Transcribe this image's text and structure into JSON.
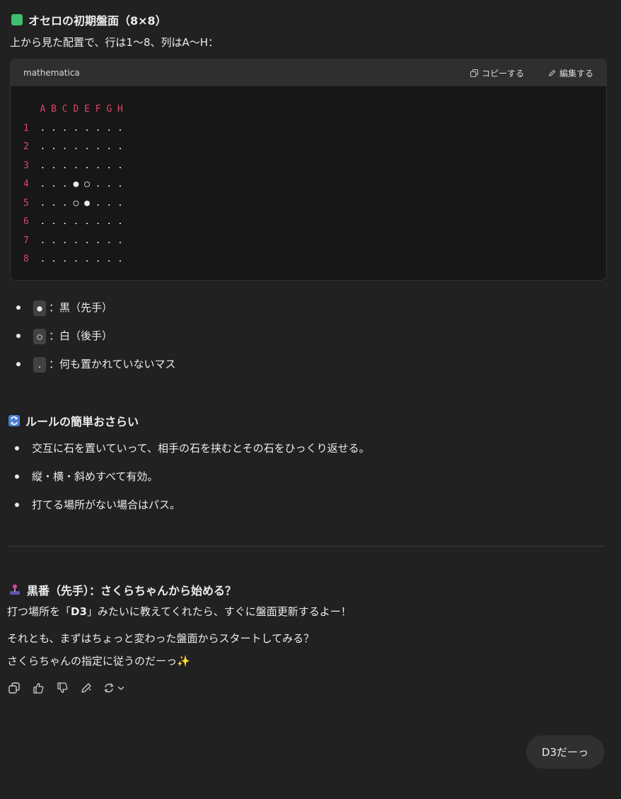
{
  "section1": {
    "title": "オセロの初期盤面（8×8）",
    "desc": "上から見た配置で、行は1〜8、列はA〜H："
  },
  "code": {
    "lang": "mathematica",
    "copy_label": "コピーする",
    "edit_label": "編集する",
    "header_row": "A B C D E F G H",
    "rows": [
      {
        "num": "1",
        "cells": ". . . . . . . ."
      },
      {
        "num": "2",
        "cells": ". . . . . . . ."
      },
      {
        "num": "3",
        "cells": ". . . . . . . ."
      },
      {
        "num": "4",
        "cells": ". . . ● ○ . . ."
      },
      {
        "num": "5",
        "cells": ". . . ○ ● . . ."
      },
      {
        "num": "6",
        "cells": ". . . . . . . ."
      },
      {
        "num": "7",
        "cells": ". . . . . . . ."
      },
      {
        "num": "8",
        "cells": ". . . . . . . ."
      }
    ]
  },
  "legend": [
    {
      "chip": "●",
      "text": "：黒（先手）"
    },
    {
      "chip": "○",
      "text": "：白（後手）"
    },
    {
      "chip": ".",
      "text": "：何も置かれていないマス"
    }
  ],
  "section2": {
    "title": "ルールの簡単おさらい",
    "items": [
      "交互に石を置いていって、相手の石を挟むとその石をひっくり返せる。",
      "縦・横・斜めすべて有効。",
      "打てる場所がない場合はパス。"
    ]
  },
  "section3": {
    "title": "黒番（先手）：さくらちゃんから始める？",
    "line1_pre": "打つ場所を「",
    "line1_bold": "D3",
    "line1_post": "」みたいに教えてくれたら、すぐに盤面更新するよー！",
    "line2": "それとも、まずはちょっと変わった盤面からスタートしてみる？",
    "line3": "さくらちゃんの指定に従うのだーっ",
    "sparkle": "✨"
  },
  "user_bubble": "D3だーっ",
  "colors": {
    "accent_row": "#e0446a",
    "accent_col": "#e98a3a",
    "green_icon": "#3fbf6f",
    "blue_icon": "#4a7fd6"
  }
}
